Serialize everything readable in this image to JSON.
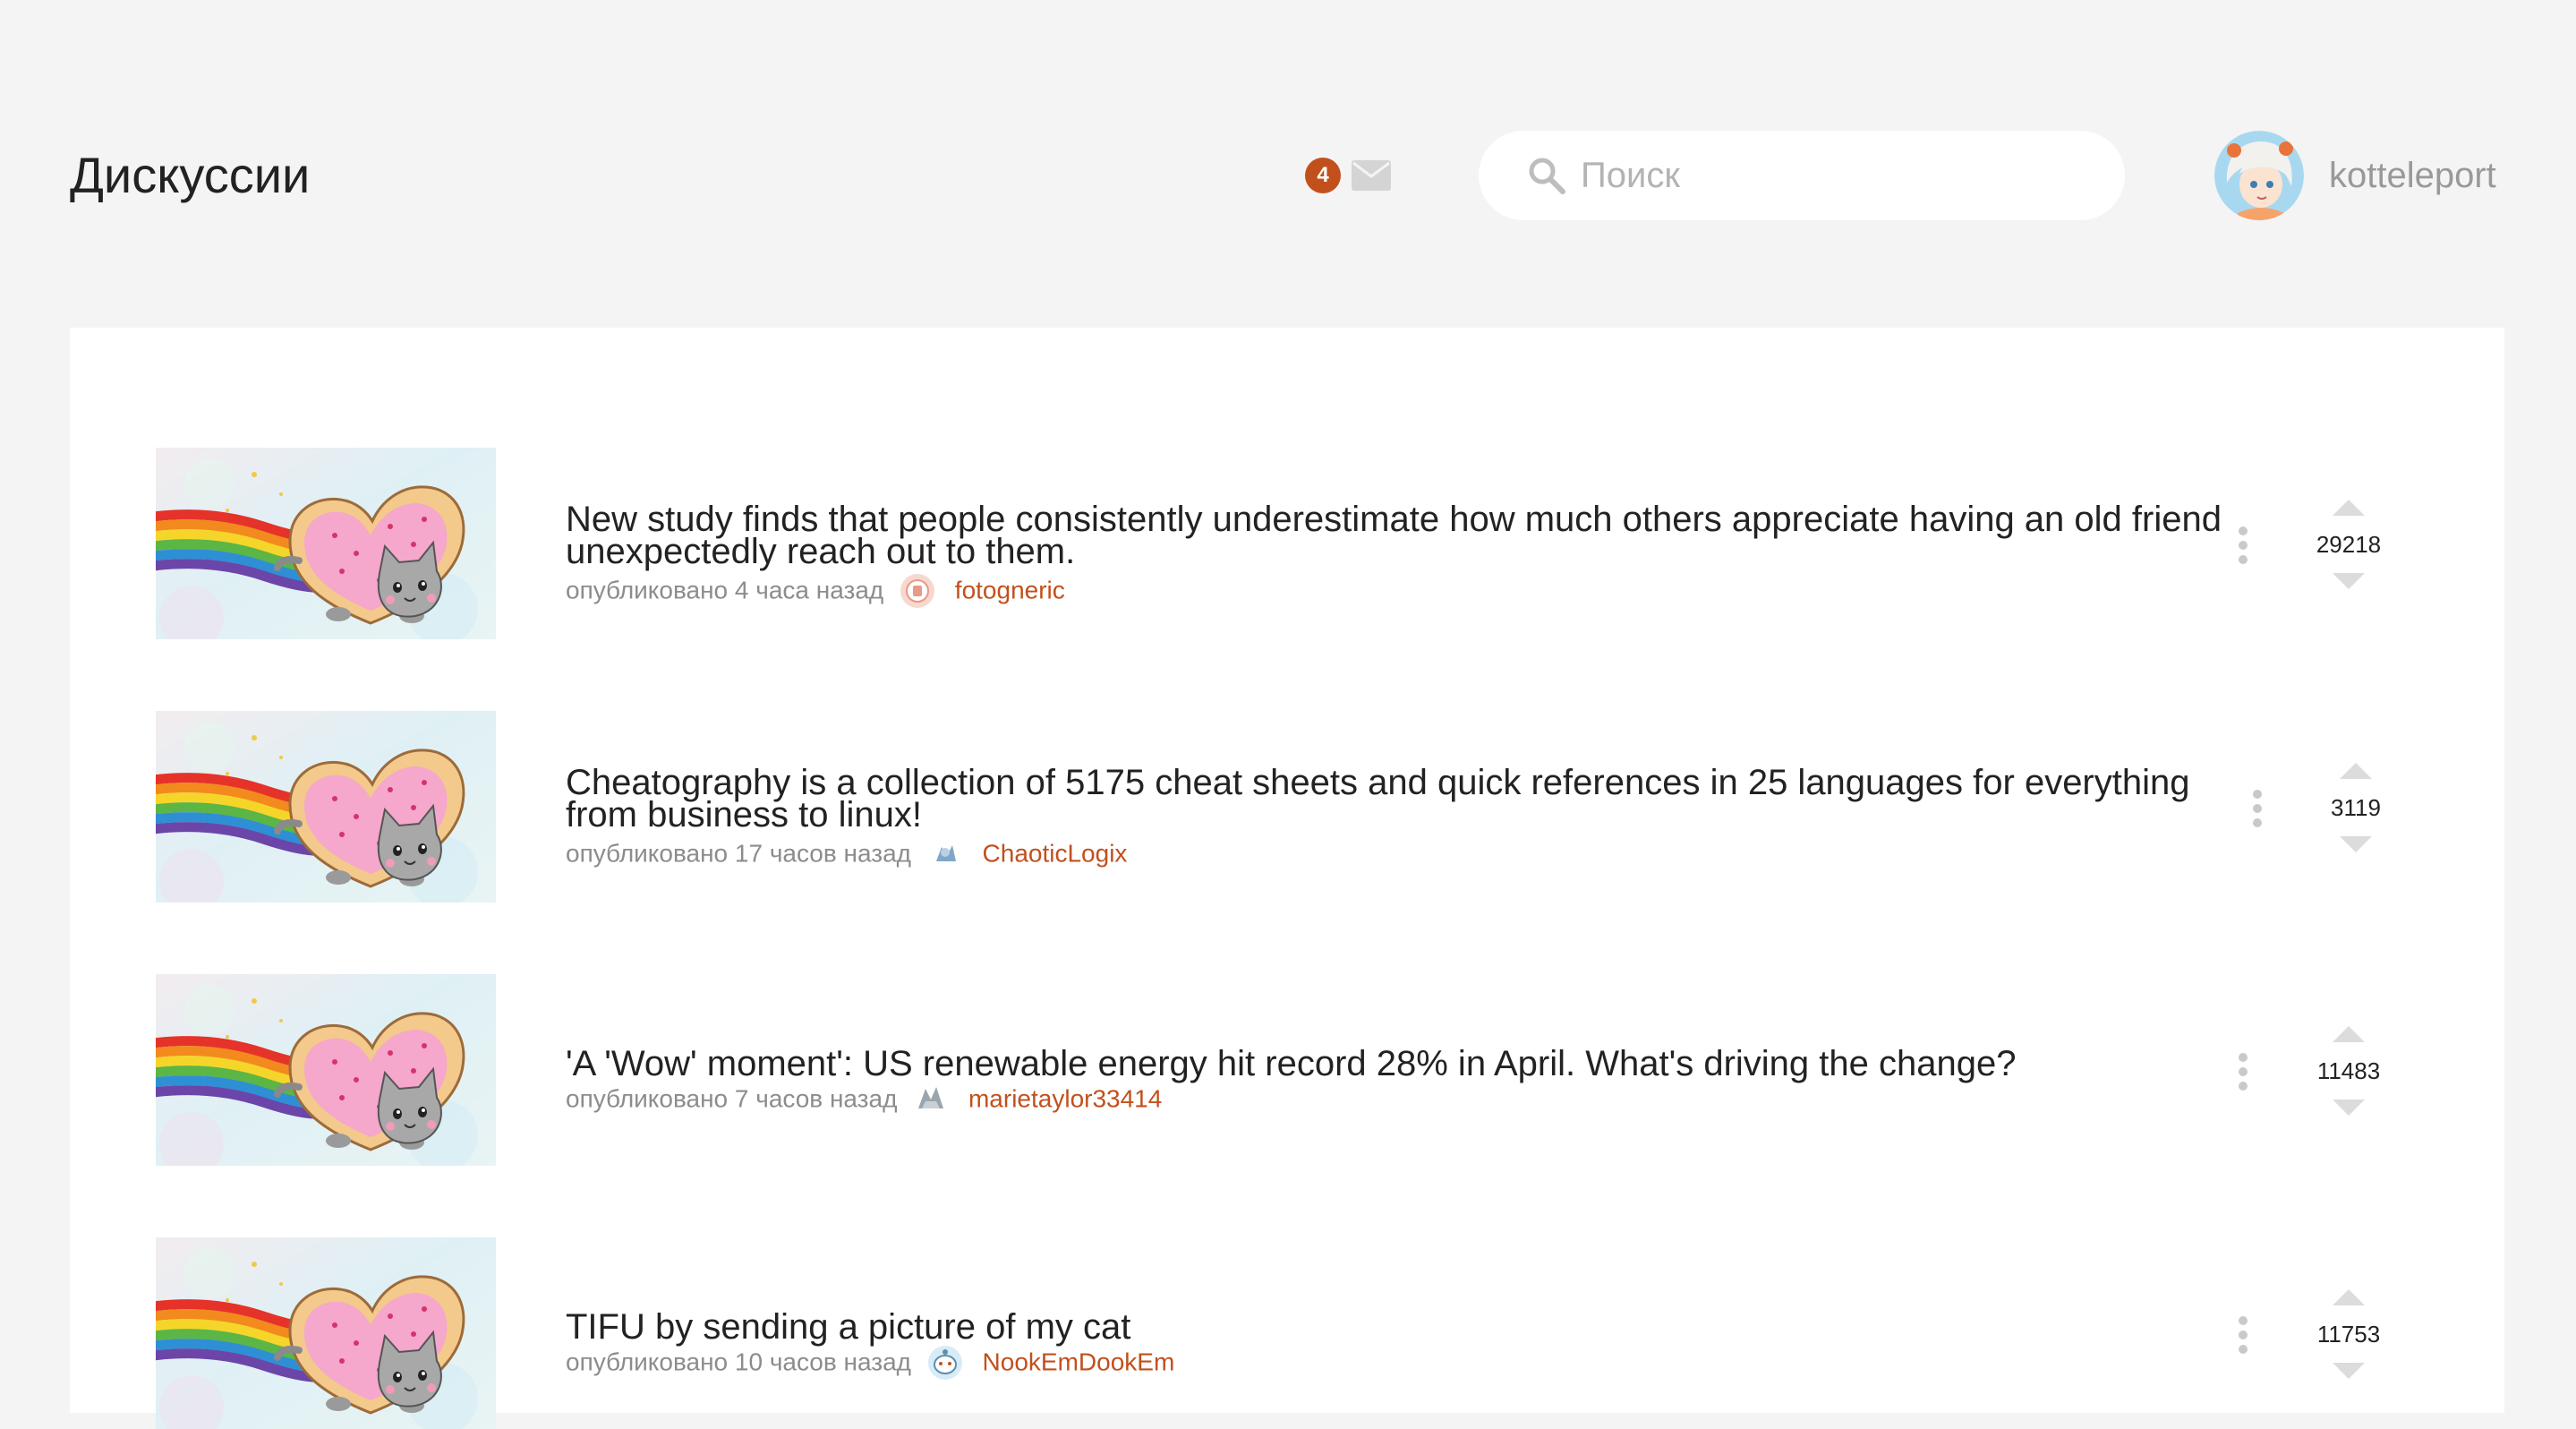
{
  "header": {
    "title": "Дискуссии",
    "mail_count": "4",
    "search_placeholder": "Поиск",
    "username": "kotteleport"
  },
  "posts": [
    {
      "title": "New study finds that people consistently underestimate how much others appreciate having an old friend unexpectedly reach out to them.",
      "meta": "опубликовано 4 часа назад",
      "author": "fotogneric",
      "score": "29218"
    },
    {
      "title": "Cheatography is a collection of 5175 cheat sheets and quick references in 25 languages for everything from business to linux!",
      "meta": "опубликовано 17 часов назад",
      "author": "ChaoticLogix",
      "score": "3119"
    },
    {
      "title": "'A 'Wow' moment': US renewable energy hit record 28% in April. What's driving the change?",
      "meta": "опубликовано 7 часов назад",
      "author": "marietaylor33414",
      "score": "11483"
    },
    {
      "title": "TIFU by sending a picture of my cat",
      "meta": "опубликовано 10 часов назад",
      "author": "NookEmDookEm",
      "score": "11753"
    }
  ],
  "colors": {
    "accent": "#c2501c",
    "background": "#f4f4f4",
    "card": "#ffffff",
    "muted_text": "#8c8c8c"
  },
  "icons": {
    "mail": "envelope-icon",
    "search": "magnifier-icon",
    "more": "vertical-ellipsis-icon",
    "vote_up": "triangle-up-icon",
    "vote_down": "triangle-down-icon"
  }
}
